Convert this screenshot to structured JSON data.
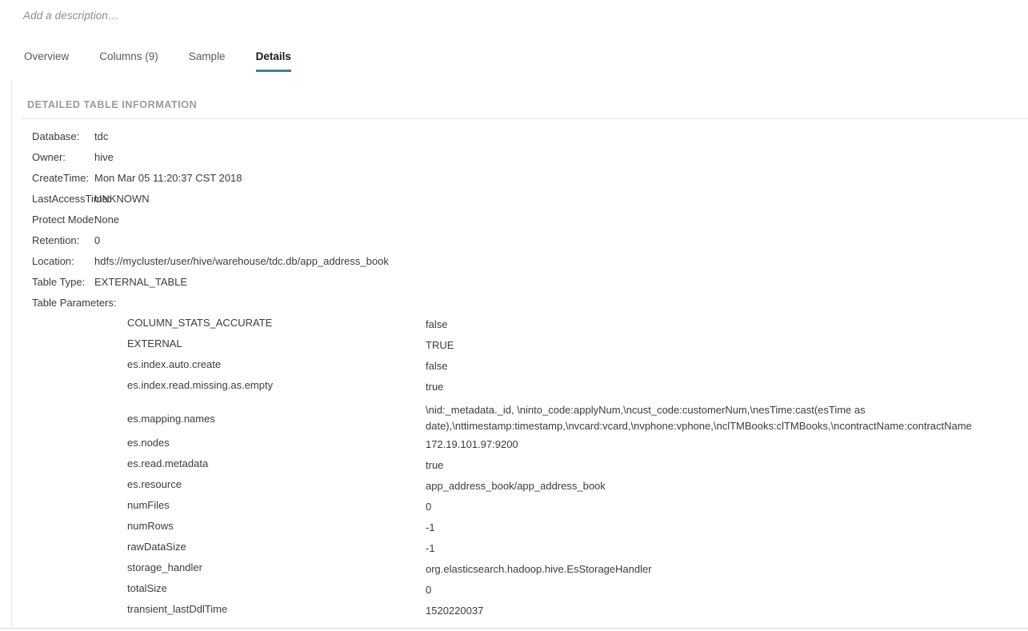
{
  "description": {
    "placeholder": "Add a description…"
  },
  "tabs": [
    {
      "label": "Overview",
      "active": false
    },
    {
      "label": "Columns (9)",
      "active": false
    },
    {
      "label": "Sample",
      "active": false
    },
    {
      "label": "Details",
      "active": true
    }
  ],
  "section": {
    "title": "DETAILED TABLE INFORMATION"
  },
  "info": [
    {
      "label": "Database:",
      "value": "tdc"
    },
    {
      "label": "Owner:",
      "value": "hive"
    },
    {
      "label": "CreateTime:",
      "value": "Mon Mar 05 11:20:37 CST 2018"
    },
    {
      "label": "LastAccessTime:",
      "value": "UNKNOWN"
    },
    {
      "label": "Protect Mode:",
      "value": "None"
    },
    {
      "label": "Retention:",
      "value": "0"
    },
    {
      "label": "Location:",
      "value": "hdfs://mycluster/user/hive/warehouse/tdc.db/app_address_book"
    },
    {
      "label": "Table Type:",
      "value": "EXTERNAL_TABLE"
    },
    {
      "label": "Table Parameters:",
      "value": ""
    }
  ],
  "table_parameters": [
    {
      "key": "COLUMN_STATS_ACCURATE",
      "value": "false"
    },
    {
      "key": "EXTERNAL",
      "value": "TRUE"
    },
    {
      "key": "es.index.auto.create",
      "value": "false"
    },
    {
      "key": "es.index.read.missing.as.empty",
      "value": "true"
    },
    {
      "key": "es.mapping.names",
      "value": "\\nid:_metadata._id, \\ninto_code:applyNum,\\ncust_code:customerNum,\\nesTime:cast(esTime as date),\\nttimestamp:timestamp,\\nvcard:vcard,\\nvphone:vphone,\\nclTMBooks:clTMBooks,\\ncontractName:contractName"
    },
    {
      "key": "es.nodes",
      "value": "172.19.101.97:9200"
    },
    {
      "key": "es.read.metadata",
      "value": "true"
    },
    {
      "key": "es.resource",
      "value": "app_address_book/app_address_book"
    },
    {
      "key": "numFiles",
      "value": "0"
    },
    {
      "key": "numRows",
      "value": "-1"
    },
    {
      "key": "rawDataSize",
      "value": "-1"
    },
    {
      "key": "storage_handler",
      "value": "org.elasticsearch.hadoop.hive.EsStorageHandler"
    },
    {
      "key": "totalSize",
      "value": "0"
    },
    {
      "key": "transient_lastDdlTime",
      "value": "1520220037"
    }
  ],
  "colors": {
    "accent": "#3a8199",
    "text": "#3c3c3c",
    "muted": "#9b9b9b",
    "rule": "#e2e2e2"
  }
}
